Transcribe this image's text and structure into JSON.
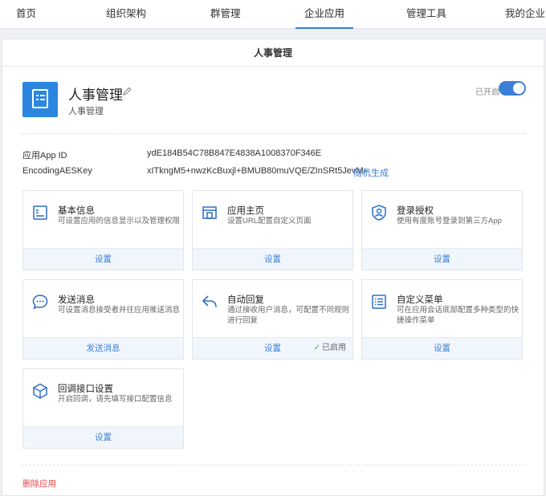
{
  "nav": {
    "items": [
      "首页",
      "组织架构",
      "群管理",
      "企业应用",
      "管理工具",
      "我的企业"
    ]
  },
  "panel": {
    "title": "人事管理"
  },
  "app": {
    "name": "人事管理",
    "subtitle": "人事管理",
    "toggle_label": "已开启",
    "enabled": true
  },
  "credentials": {
    "appid_label": "应用App ID",
    "appid_value": "ydE184B54C78B847E4838A1008370F346E",
    "aes_label": "EncodingAESKey",
    "aes_value": "xITkngM5+nwzKcBuxjl+BMUB80muVQE/ZInSRt5JevM=",
    "aes_action": "随机生成"
  },
  "cards": [
    {
      "title": "基本信息",
      "desc": "可设置应用的信息显示以及管理权限",
      "action": "设置",
      "icon": "info-doc-icon"
    },
    {
      "title": "应用主页",
      "desc": "设置URL配置自定义页面",
      "action": "设置",
      "icon": "homepage-icon"
    },
    {
      "title": "登录授权",
      "desc": "使用有度账号登录到第三方App",
      "action": "设置",
      "icon": "shield-user-icon"
    },
    {
      "title": "发送消息",
      "desc": "可设置消息接受者并往应用推送消息",
      "action": "发送消息",
      "icon": "chat-bubble-icon"
    },
    {
      "title": "自动回复",
      "desc": "通过接收用户消息，可配置不同规则进行回复",
      "action": "设置",
      "status": "已启用",
      "icon": "reply-arrow-icon"
    },
    {
      "title": "自定义菜单",
      "desc": "可在应用会话底部配置多种类型的快捷操作菜单",
      "action": "设置",
      "icon": "menu-list-icon"
    },
    {
      "title": "回调接口设置",
      "desc": "开启回调，请先填写接口配置信息",
      "action": "设置",
      "icon": "cube-icon"
    }
  ],
  "delete_label": "删除应用",
  "colors": {
    "accent": "#3b7fd6",
    "logo": "#2a86e0",
    "danger": "#e0484e",
    "success": "#2bb24c"
  }
}
